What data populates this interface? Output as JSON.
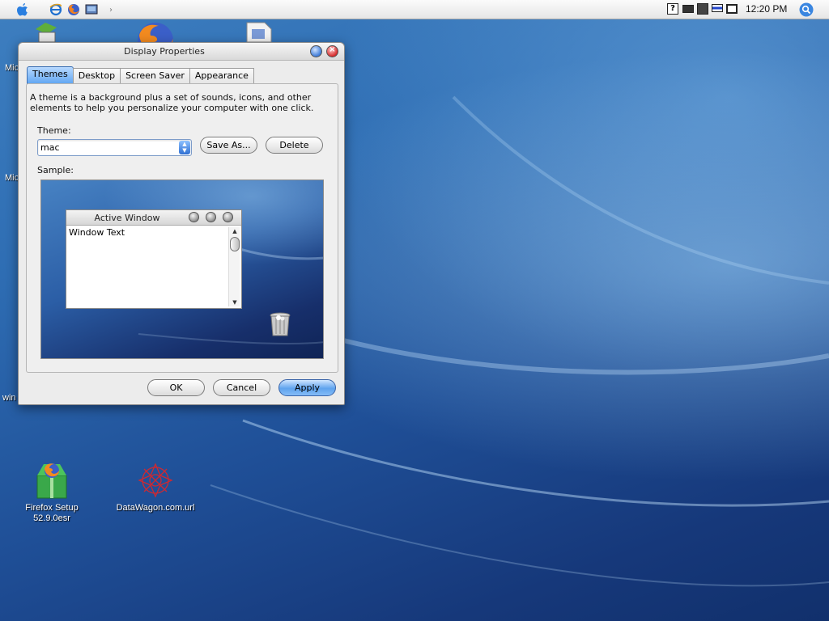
{
  "desktop": {
    "icons": [
      {
        "label": "Firefox Setup\n52.9.0esr"
      },
      {
        "label": "DataWagon.com.url"
      }
    ],
    "partial_labels": [
      "Mic",
      "Mic",
      "win"
    ]
  },
  "menubar": {
    "clock": "12:20 PM"
  },
  "dialog": {
    "title": "Display Properties",
    "tabs": [
      "Themes",
      "Desktop",
      "Screen Saver",
      "Appearance"
    ],
    "active_tab": "Themes",
    "description": "A theme is a background plus a set of sounds, icons, and other elements to help you personalize your computer with one click.",
    "theme_label": "Theme:",
    "theme_value": "mac",
    "save_as_label": "Save As...",
    "delete_label": "Delete",
    "sample_label": "Sample:",
    "sample": {
      "window_title": "Active Window",
      "window_text": "Window Text"
    },
    "ok_label": "OK",
    "cancel_label": "Cancel",
    "apply_label": "Apply"
  },
  "colors": {
    "accent": "#5ea5f2",
    "desktop": "#2e6db3"
  }
}
